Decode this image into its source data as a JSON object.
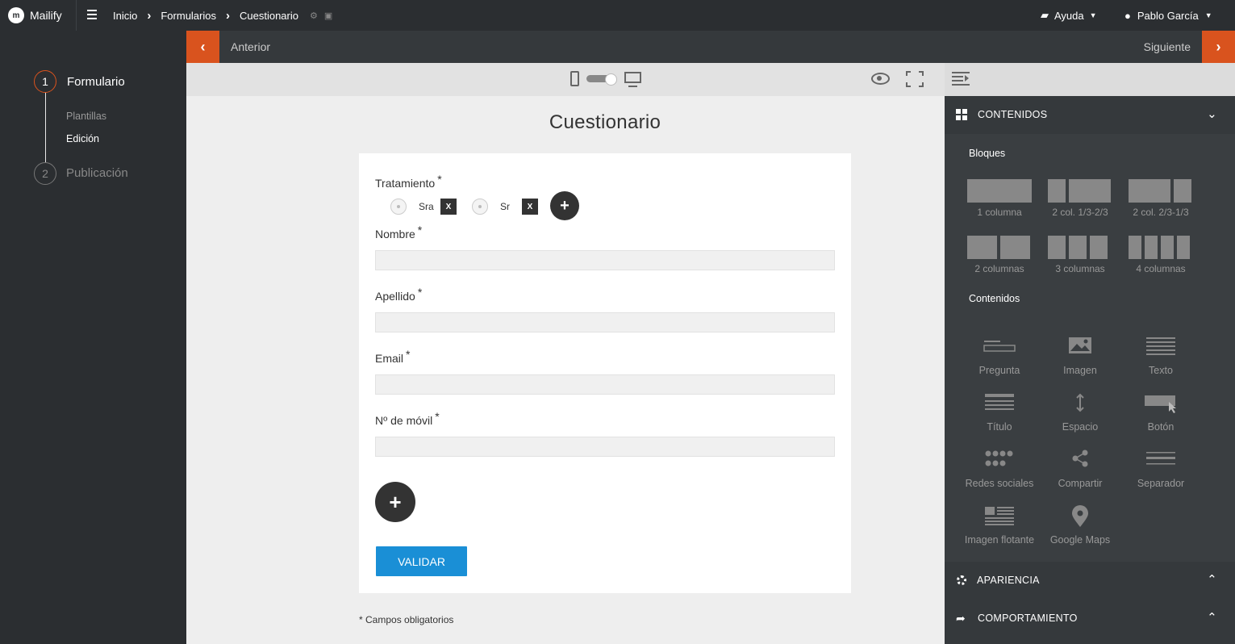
{
  "app": {
    "name": "Mailify"
  },
  "topbar": {
    "breadcrumbs": [
      "Inicio",
      "Formularios",
      "Cuestionario"
    ],
    "help_label": "Ayuda",
    "user_name": "Pablo García"
  },
  "steps": [
    {
      "number": "1",
      "label": "Formulario",
      "substeps": [
        "Plantillas",
        "Edición"
      ],
      "current_substep": "Edición"
    },
    {
      "number": "2",
      "label": "Publicación"
    }
  ],
  "nav": {
    "prev_label": "Anterior",
    "next_label": "Siguiente"
  },
  "form": {
    "title": "Cuestionario",
    "fields": [
      {
        "label": "Tratamiento",
        "type": "radio",
        "options": [
          "Sra",
          "Sr"
        ]
      },
      {
        "label": "Nombre",
        "type": "text",
        "value": ""
      },
      {
        "label": "Apellido",
        "type": "text",
        "value": ""
      },
      {
        "label": "Email",
        "type": "text",
        "value": ""
      },
      {
        "label": "Nº de móvil",
        "type": "text",
        "value": ""
      }
    ],
    "required_mark": "*",
    "remove_label": "X",
    "add_label": "+",
    "submit_label": "VALIDAR",
    "required_note": "* Campos obligatorios"
  },
  "rightpanel": {
    "contenidos": {
      "title": "CONTENIDOS",
      "blocks_title": "Bloques",
      "blocks": [
        "1 columna",
        "2 col. 1/3-2/3",
        "2 col. 2/3-1/3",
        "2 columnas",
        "3 columnas",
        "4 columnas"
      ],
      "contents_title": "Contenidos",
      "contents": [
        {
          "label": "Pregunta",
          "icon": "question-field-icon"
        },
        {
          "label": "Imagen",
          "icon": "image-icon"
        },
        {
          "label": "Texto",
          "icon": "text-lines-icon"
        },
        {
          "label": "Título",
          "icon": "title-icon"
        },
        {
          "label": "Espacio",
          "icon": "spacer-icon"
        },
        {
          "label": "Botón",
          "icon": "button-icon"
        },
        {
          "label": "Redes sociales",
          "icon": "social-networks-icon"
        },
        {
          "label": "Compartir",
          "icon": "share-icon"
        },
        {
          "label": "Separador",
          "icon": "separator-icon"
        },
        {
          "label": "Imagen flotante",
          "icon": "floating-image-icon"
        },
        {
          "label": "Google Maps",
          "icon": "map-pin-icon"
        }
      ]
    },
    "apariencia": {
      "title": "APARIENCIA"
    },
    "comportamiento": {
      "title": "COMPORTAMIENTO"
    }
  },
  "colors": {
    "accent": "#d9531e",
    "submit": "#1a8fd6",
    "dark": "#2b2e31"
  }
}
